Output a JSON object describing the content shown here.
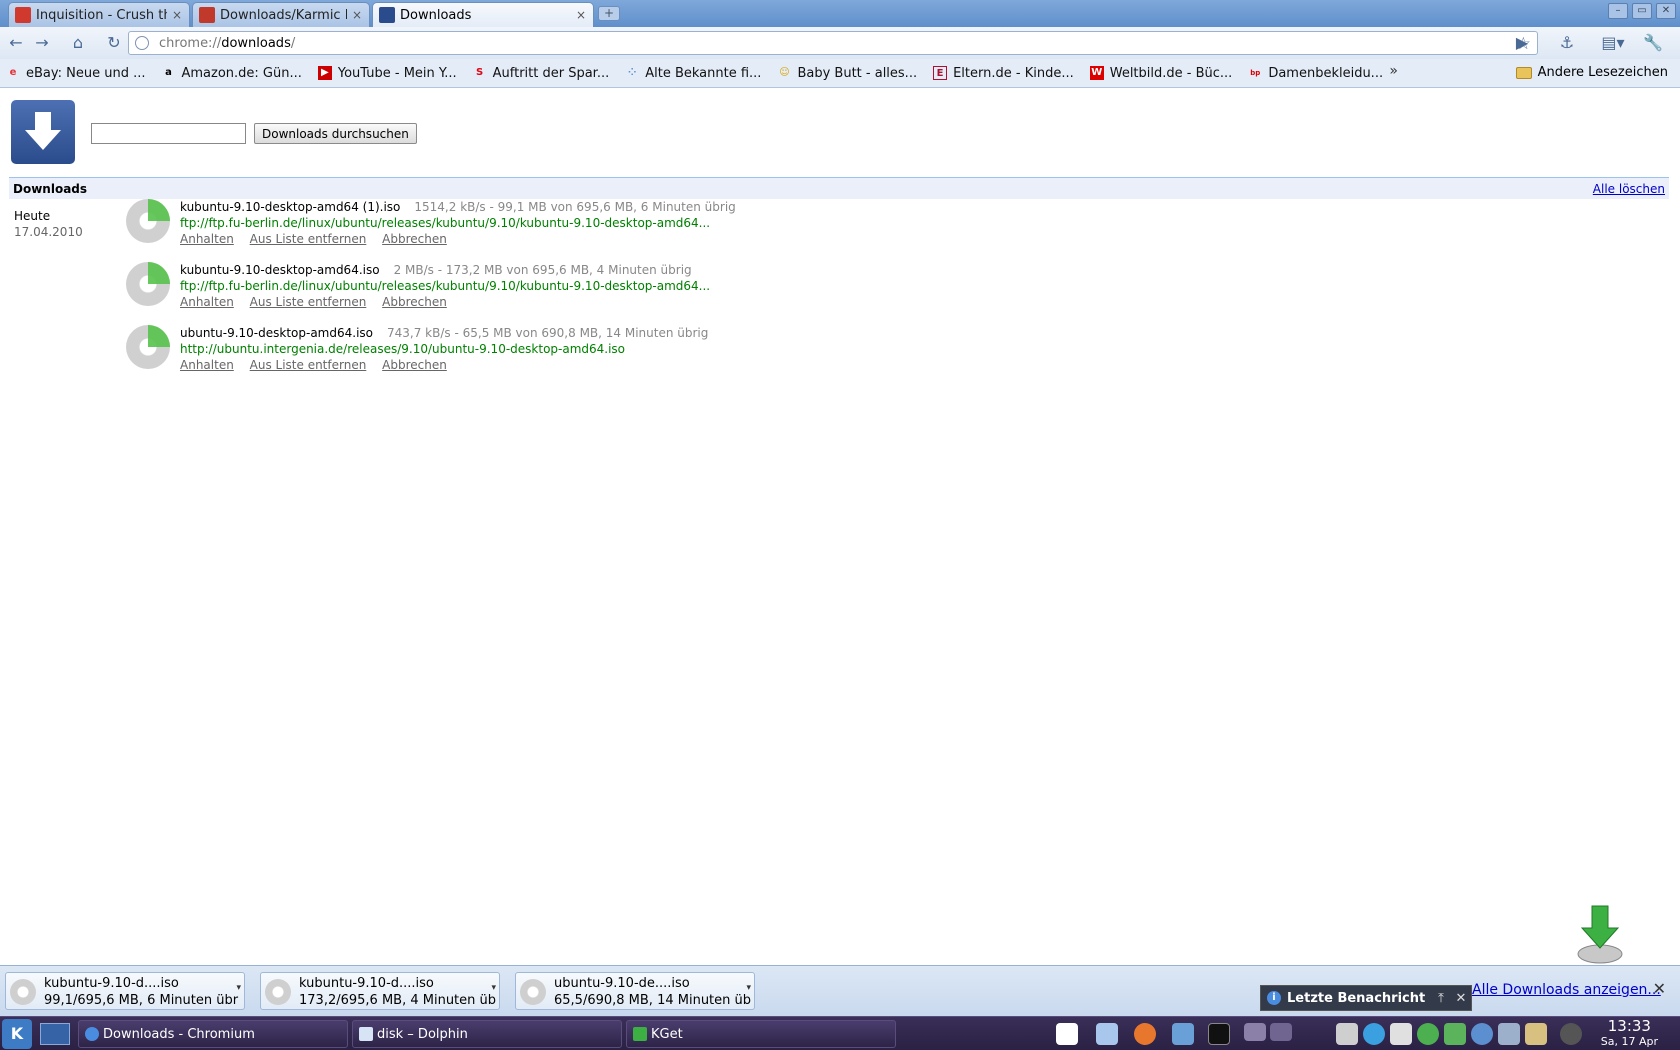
{
  "tabs": [
    {
      "title": "Inquisition - Crush th...",
      "favicon": "og-icon",
      "color": "#d03a2e"
    },
    {
      "title": "Downloads/Karmic Ko...",
      "favicon": "bookmark-icon",
      "color": "#c0392b"
    },
    {
      "title": "Downloads",
      "favicon": "downloads-icon",
      "color": "#2b4c8c"
    }
  ],
  "toolbar": {
    "url_scheme": "chrome://",
    "url_host": "downloads",
    "url_path": "/"
  },
  "bookmarks": [
    {
      "label": "eBay: Neue und ...",
      "icon": "ebay-icon"
    },
    {
      "label": "Amazon.de: Gün...",
      "icon": "amazon-icon"
    },
    {
      "label": "YouTube - Mein Y...",
      "icon": "youtube-icon"
    },
    {
      "label": "Auftritt der Spar...",
      "icon": "sparkasse-icon"
    },
    {
      "label": "Alte Bekannte fi...",
      "icon": "dots-icon"
    },
    {
      "label": "Baby Butt - alles...",
      "icon": "face-icon"
    },
    {
      "label": "Eltern.de - Kinde...",
      "icon": "eltern-icon"
    },
    {
      "label": "Weltbild.de - Büc...",
      "icon": "weltbild-icon"
    },
    {
      "label": "Damenbekleidu...",
      "icon": "bonprix-icon"
    }
  ],
  "bookmarks_other": "Andere Lesezeichen",
  "page": {
    "search_button": "Downloads durchsuchen",
    "section_title": "Downloads",
    "clear_all": "Alle löschen",
    "day_label": "Heute",
    "date": "17.04.2010"
  },
  "downloads": [
    {
      "name": "kubuntu-9.10-desktop-amd64 (1).iso",
      "status": "1514,2 kB/s - 99,1 MB von 695,6 MB, 6 Minuten übrig",
      "url": "ftp://ftp.fu-berlin.de/linux/ubuntu/releases/kubuntu/9.10/kubuntu-9.10-desktop-amd64...",
      "actions": [
        "Anhalten",
        "Aus Liste entfernen",
        "Abbrechen"
      ],
      "progress": 0.14
    },
    {
      "name": "kubuntu-9.10-desktop-amd64.iso",
      "status": "2 MB/s - 173,2 MB von 695,6 MB, 4 Minuten übrig",
      "url": "ftp://ftp.fu-berlin.de/linux/ubuntu/releases/kubuntu/9.10/kubuntu-9.10-desktop-amd64...",
      "actions": [
        "Anhalten",
        "Aus Liste entfernen",
        "Abbrechen"
      ],
      "progress": 0.25
    },
    {
      "name": "ubuntu-9.10-desktop-amd64.iso",
      "status": "743,7 kB/s - 65,5 MB von 690,8 MB, 14 Minuten übrig",
      "url": "http://ubuntu.intergenia.de/releases/9.10/ubuntu-9.10-desktop-amd64.iso",
      "actions": [
        "Anhalten",
        "Aus Liste entfernen",
        "Abbrechen"
      ],
      "progress": 0.09
    }
  ],
  "shelf": {
    "items": [
      {
        "name": "kubuntu-9.10-d....iso",
        "status": "99,1/695,6 MB, 6 Minuten übr"
      },
      {
        "name": "kubuntu-9.10-d....iso",
        "status": "173,2/695,6 MB, 4 Minuten üb"
      },
      {
        "name": "ubuntu-9.10-de....iso",
        "status": "65,5/690,8 MB, 14 Minuten üb"
      }
    ],
    "show_all": "Alle Downloads anzeigen..."
  },
  "notification": {
    "title": "Letzte Benachricht"
  },
  "taskbar": {
    "tasks": [
      {
        "label": "Downloads - Chromium",
        "icon": "chromium-icon"
      },
      {
        "label": "disk – Dolphin",
        "icon": "dolphin-icon"
      },
      {
        "label": "KGet",
        "icon": "kget-icon"
      }
    ],
    "time": "13:33",
    "date": "Sa, 17 Apr"
  },
  "colors": {
    "accent_link": "#0000cc",
    "url_green": "#008000",
    "panel_bg": "#2f2549",
    "progress_green": "#56c24d"
  }
}
